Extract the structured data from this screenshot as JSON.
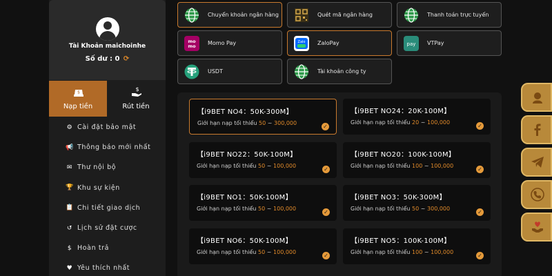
{
  "account": {
    "name": "Tài Khoản maichoinhe",
    "balance_label": "Số dư :",
    "balance_value": "0"
  },
  "tabs": [
    {
      "label": "Nạp tiền",
      "icon": "money-bag-icon",
      "active": true
    },
    {
      "label": "Rút tiền",
      "icon": "withdraw-hand-icon",
      "active": false
    }
  ],
  "menu": [
    {
      "label": "Cài đặt bảo mật",
      "icon": "user-cog-icon"
    },
    {
      "label": "Thông báo mới nhất",
      "icon": "megaphone-icon"
    },
    {
      "label": "Thư nội bộ",
      "icon": "envelope-icon"
    },
    {
      "label": "Khu sự kiện",
      "icon": "trophy-icon"
    },
    {
      "label": "Chi tiết giao dịch",
      "icon": "clipboard-icon"
    },
    {
      "label": "Lịch sử đặt cược",
      "icon": "history-icon"
    },
    {
      "label": "Hoàn trả",
      "icon": "dollar-circle-icon"
    },
    {
      "label": "Yêu thích nhất",
      "icon": "heart-icon"
    }
  ],
  "payment_methods": [
    {
      "label": "Chuyển khoản ngân hàng",
      "icon": "globe-icon",
      "selected": true
    },
    {
      "label": "Quét mã ngân hàng",
      "icon": "qr-code-icon",
      "selected": false
    },
    {
      "label": "Thanh toán trực tuyến",
      "icon": "globe-icon",
      "selected": false
    },
    {
      "label": "Momo Pay",
      "icon": "momo-logo-icon",
      "selected": false
    },
    {
      "label": "ZaloPay",
      "icon": "zalopay-logo-icon",
      "selected": true
    },
    {
      "label": "VTPay",
      "icon": "vtpay-logo-icon",
      "selected": false
    },
    {
      "label": "USDT",
      "icon": "tether-icon",
      "selected": false
    },
    {
      "label": "Tài khoản công ty",
      "icon": "globe-icon",
      "selected": false
    }
  ],
  "packages": [
    {
      "name": "【i9BET NO4：50K-300M】",
      "limit_label": "Giới hạn nạp tối thiểu",
      "min": "50",
      "sep": "~",
      "max": "300,000",
      "selected": true
    },
    {
      "name": "【i9BET NO24：20K-100M】",
      "limit_label": "Giới hạn nạp tối thiểu",
      "min": "20",
      "sep": "~",
      "max": "100,000",
      "selected": false
    },
    {
      "name": "【i9BET NO22：50K-100M】",
      "limit_label": "Giới hạn nạp tối thiểu",
      "min": "50",
      "sep": "~",
      "max": "100,000",
      "selected": false
    },
    {
      "name": "【i9BET NO20：100K-100M】",
      "limit_label": "Giới hạn nạp tối thiểu",
      "min": "100",
      "sep": "~",
      "max": "100,000",
      "selected": false
    },
    {
      "name": "【i9BET NO1：50K-100M】",
      "limit_label": "Giới hạn nạp tối thiểu",
      "min": "50",
      "sep": "~",
      "max": "100,000",
      "selected": false
    },
    {
      "name": "【i9BET NO3：50K-300M】",
      "limit_label": "Giới hạn nạp tối thiểu",
      "min": "50",
      "sep": "~",
      "max": "300,000",
      "selected": false
    },
    {
      "name": "【i9BET NO6：50K-100M】",
      "limit_label": "Giới hạn nạp tối thiểu",
      "min": "50",
      "sep": "~",
      "max": "100,000",
      "selected": false
    },
    {
      "name": "【i9BET NO5：100K-100M】",
      "limit_label": "Giới hạn nạp tối thiểu",
      "min": "100",
      "sep": "~",
      "max": "100,000",
      "selected": false
    }
  ],
  "side_buttons": [
    {
      "icon": "support-agent-icon"
    },
    {
      "icon": "facebook-icon"
    },
    {
      "icon": "telegram-icon"
    },
    {
      "icon": "phone-icon"
    },
    {
      "icon": "heart-hands-icon"
    }
  ],
  "colors": {
    "accent": "#c97a2e",
    "active_tab": "#b16a27",
    "min_value": "#e08a2a",
    "side_gold": "#b8893a"
  }
}
